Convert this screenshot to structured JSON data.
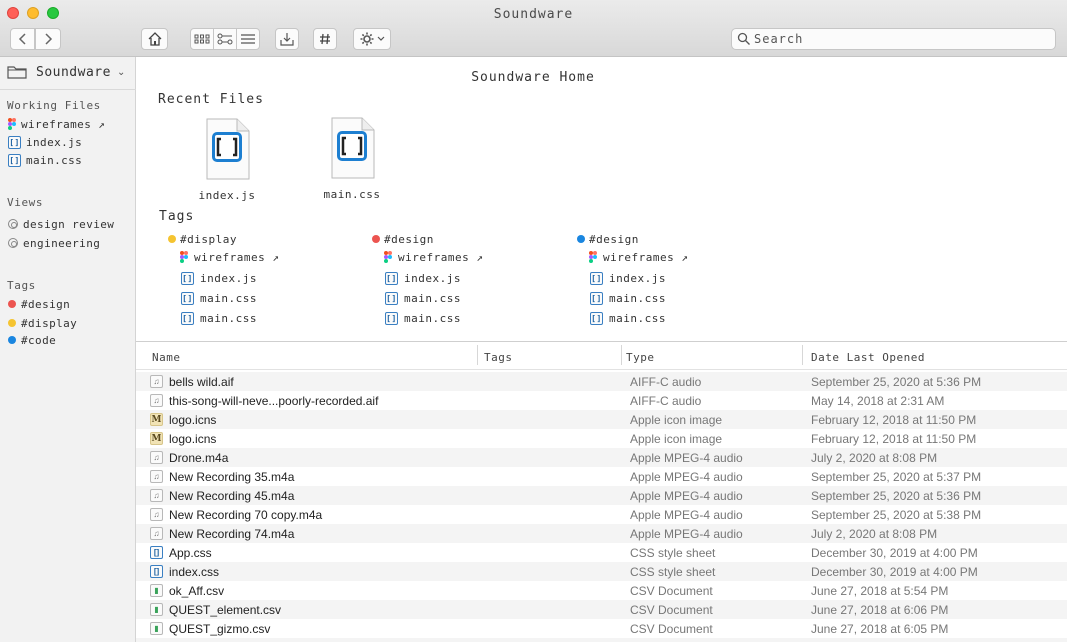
{
  "window": {
    "title": "Soundware"
  },
  "toolbar": {
    "search_placeholder": "Search"
  },
  "sidebar": {
    "header": "Soundware",
    "sections": {
      "working_files": {
        "label": "Working Files",
        "items": [
          {
            "label": "wireframes ↗",
            "icon": "figma-icon"
          },
          {
            "label": "index.js",
            "icon": "brackets-file-icon"
          },
          {
            "label": "main.css",
            "icon": "brackets-file-icon"
          }
        ]
      },
      "views": {
        "label": "Views",
        "items": [
          {
            "label": "design review",
            "icon": "view-icon"
          },
          {
            "label": "engineering",
            "icon": "view-icon"
          }
        ]
      },
      "tags": {
        "label": "Tags",
        "items": [
          {
            "label": "#design",
            "color": "#ec5450"
          },
          {
            "label": "#display",
            "color": "#f5c431"
          },
          {
            "label": "#code",
            "color": "#1a86e0"
          }
        ]
      }
    }
  },
  "main": {
    "title": "Soundware Home",
    "recent_label": "Recent Files",
    "recent_files": [
      {
        "name": "index.js"
      },
      {
        "name": "main.css"
      }
    ],
    "tags_label": "Tags",
    "tag_groups": [
      {
        "tag": "#display",
        "color": "#f5c431",
        "files": [
          "wireframes ↗",
          "index.js",
          "main.css",
          "main.css"
        ]
      },
      {
        "tag": "#design",
        "color": "#ec5450",
        "files": [
          "wireframes ↗",
          "index.js",
          "main.css",
          "main.css"
        ]
      },
      {
        "tag": "#design",
        "color": "#1a86e0",
        "files": [
          "wireframes ↗",
          "index.js",
          "main.css",
          "main.css"
        ]
      }
    ]
  },
  "list": {
    "columns": {
      "name": "Name",
      "tags": "Tags",
      "type": "Type",
      "date": "Date Last Opened"
    },
    "rows": [
      {
        "name": "bells wild.aif",
        "type": "AIFF-C audio",
        "date": "September 25, 2020 at 5:36 PM",
        "icon": "audio-file-icon"
      },
      {
        "name": "this-song-will-neve...poorly-recorded.aif",
        "type": "AIFF-C audio",
        "date": "May 14, 2018 at 2:31 AM",
        "icon": "audio-file-icon"
      },
      {
        "name": "logo.icns",
        "type": "Apple icon image",
        "date": "February 12, 2018 at 11:50 PM",
        "icon": "icns-file-icon"
      },
      {
        "name": "logo.icns",
        "type": "Apple icon image",
        "date": "February 12, 2018 at 11:50 PM",
        "icon": "icns-file-icon"
      },
      {
        "name": "Drone.m4a",
        "type": "Apple MPEG-4 audio",
        "date": "July 2, 2020 at 8:08 PM",
        "icon": "audio-file-icon"
      },
      {
        "name": "New Recording 35.m4a",
        "type": "Apple MPEG-4 audio",
        "date": "September 25, 2020 at 5:37 PM",
        "icon": "audio-file-icon"
      },
      {
        "name": "New Recording 45.m4a",
        "type": "Apple MPEG-4 audio",
        "date": "September 25, 2020 at 5:36 PM",
        "icon": "audio-file-icon"
      },
      {
        "name": "New Recording 70 copy.m4a",
        "type": "Apple MPEG-4 audio",
        "date": "September 25, 2020 at 5:38 PM",
        "icon": "audio-file-icon"
      },
      {
        "name": "New Recording 74.m4a",
        "type": "Apple MPEG-4 audio",
        "date": "July 2, 2020 at 8:08 PM",
        "icon": "audio-file-icon"
      },
      {
        "name": "App.css",
        "type": "CSS style sheet",
        "date": "December 30, 2019 at 4:00 PM",
        "icon": "css-file-icon"
      },
      {
        "name": "index.css",
        "type": "CSS style sheet",
        "date": "December 30, 2019 at 4:00 PM",
        "icon": "css-file-icon"
      },
      {
        "name": "ok_Aff.csv",
        "type": "CSV Document",
        "date": "June 27, 2018 at 5:54 PM",
        "icon": "csv-file-icon"
      },
      {
        "name": "QUEST_element.csv",
        "type": "CSV Document",
        "date": "June 27, 2018 at 6:06 PM",
        "icon": "csv-file-icon"
      },
      {
        "name": "QUEST_gizmo.csv",
        "type": "CSV Document",
        "date": "June 27, 2018 at 6:05 PM",
        "icon": "csv-file-icon"
      }
    ]
  }
}
